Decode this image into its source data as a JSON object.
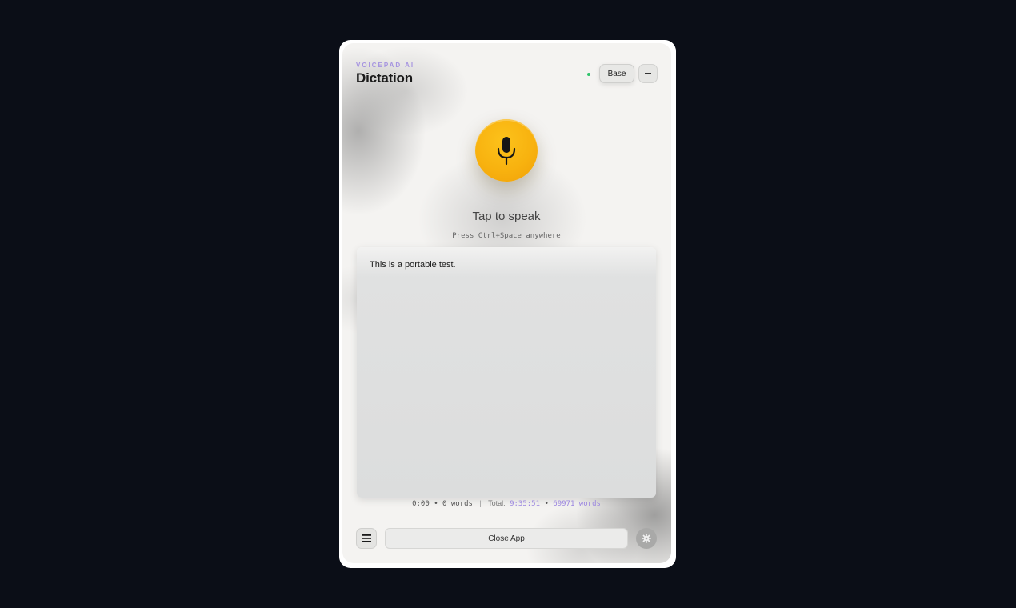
{
  "header": {
    "brand": "VOICEPAD AI",
    "title": "Dictation",
    "model_label": "Base",
    "status_color": "#2fc46b"
  },
  "recorder": {
    "icon": "microphone-icon",
    "prompt": "Tap to speak",
    "hint": "Press Ctrl+Space anywhere"
  },
  "transcript": {
    "text": "This is a portable test."
  },
  "stats": {
    "session_time": "0:00",
    "session_words": "0 words",
    "total_label": "Total:",
    "total_time": "9:35:51",
    "total_words": "69971 words"
  },
  "footer": {
    "menu_icon": "hamburger-menu-icon",
    "close_label": "Close App",
    "settings_icon": "gear-icon"
  },
  "colors": {
    "accent": "#9b86e0",
    "mic": "#f8b20f",
    "background": "#0b0e17"
  }
}
